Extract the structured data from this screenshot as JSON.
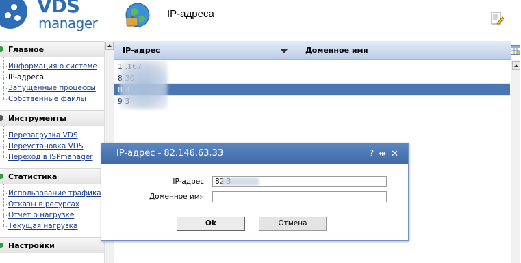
{
  "brand": {
    "line1": "VDS",
    "line2": "manager",
    "color": "#2e6db5"
  },
  "header": {
    "title": "IP-адреса",
    "icon": "globe-icon",
    "action_icon": "edit-document-icon"
  },
  "sidebar": {
    "sections": [
      {
        "title": "Главное",
        "mark_color": "#2f9d3a",
        "items": [
          {
            "label": "Информация о системе",
            "link": true
          },
          {
            "label": "IP-адреса",
            "link": false
          },
          {
            "label": "Запущенные процессы",
            "link": true
          },
          {
            "label": "Собственные файлы",
            "link": true
          }
        ]
      },
      {
        "title": "Инструменты",
        "mark_color": "#555555",
        "items": [
          {
            "label": "Перезагрузка VDS",
            "link": true
          },
          {
            "label": "Переустановка VDS",
            "link": true
          },
          {
            "label": "Переход в ISPmanager",
            "link": true
          }
        ]
      },
      {
        "title": "Статистика",
        "mark_color": "#2f9d3a",
        "items": [
          {
            "label": "Использование трафика",
            "link": true
          },
          {
            "label": "Отказы в ресурсах",
            "link": true
          },
          {
            "label": "Отчёт о нагрузке",
            "link": true
          },
          {
            "label": "Текущая нагрузка",
            "link": true
          }
        ]
      },
      {
        "title": "Настройки",
        "mark_color": "#2f9d3a",
        "items": []
      }
    ]
  },
  "table": {
    "columns": [
      "IP-адрес",
      "Доменное имя"
    ],
    "sort_column": 0,
    "rows": [
      {
        "ip": "1             .167",
        "domain": ""
      },
      {
        "ip": "8              30",
        "domain": ""
      },
      {
        "ip": "8              3",
        "domain": "",
        "selected": true
      },
      {
        "ip": "9              3",
        "domain": ""
      }
    ]
  },
  "dialog": {
    "title": "IP-адрес - 82.146.63.33",
    "tools": [
      "?",
      "⇹",
      "✕"
    ],
    "fields": [
      {
        "label": "IP-адрес",
        "value": "82           3"
      },
      {
        "label": "Доменное имя",
        "value": ""
      }
    ],
    "ok_label": "Ok",
    "cancel_label": "Отмена"
  },
  "colors": {
    "accent": "#4a76b1",
    "selected_row": "#4a76b1",
    "dialog_title": "#4a75b3"
  }
}
